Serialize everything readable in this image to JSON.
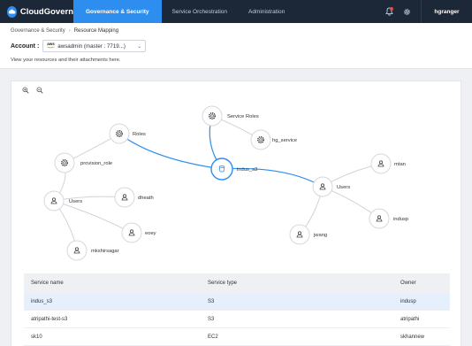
{
  "nav": {
    "brand": "CloudGovern",
    "tabs": [
      "Governance & Security",
      "Service Orchestration",
      "Administration"
    ],
    "user": "hgranger"
  },
  "breadcrumb": {
    "parent": "Governance & Security",
    "current": "Resource Mapping"
  },
  "account": {
    "label": "Account :",
    "provider": "aws",
    "value": "awsadmin (master : 7719...)"
  },
  "description": "View your resources and their attachments here.",
  "graph": {
    "center": "indus_s3",
    "nodes": {
      "roles_left": "Roles",
      "provision_role": "provision_role",
      "users_left": "Users",
      "dheath": "dheath",
      "eoey": "eoey",
      "mkshirsagar": "mkshirsagar",
      "service_roles": "Service Roles",
      "hg_service": "hg_service",
      "users_right": "Users",
      "mtan": "mtan",
      "indusp": "indusp",
      "jwang": "jwang"
    }
  },
  "table": {
    "headers": [
      "Service name",
      "Service type",
      "Owner"
    ],
    "rows": [
      {
        "name": "indus_s3",
        "type": "S3",
        "owner": "indusp"
      },
      {
        "name": "atripathi-test-s3",
        "type": "S3",
        "owner": "atripathi"
      },
      {
        "name": "sk10",
        "type": "EC2",
        "owner": "skhannew"
      }
    ]
  },
  "colors": {
    "accent": "#2d8ef0",
    "navbar": "#1c2738"
  }
}
